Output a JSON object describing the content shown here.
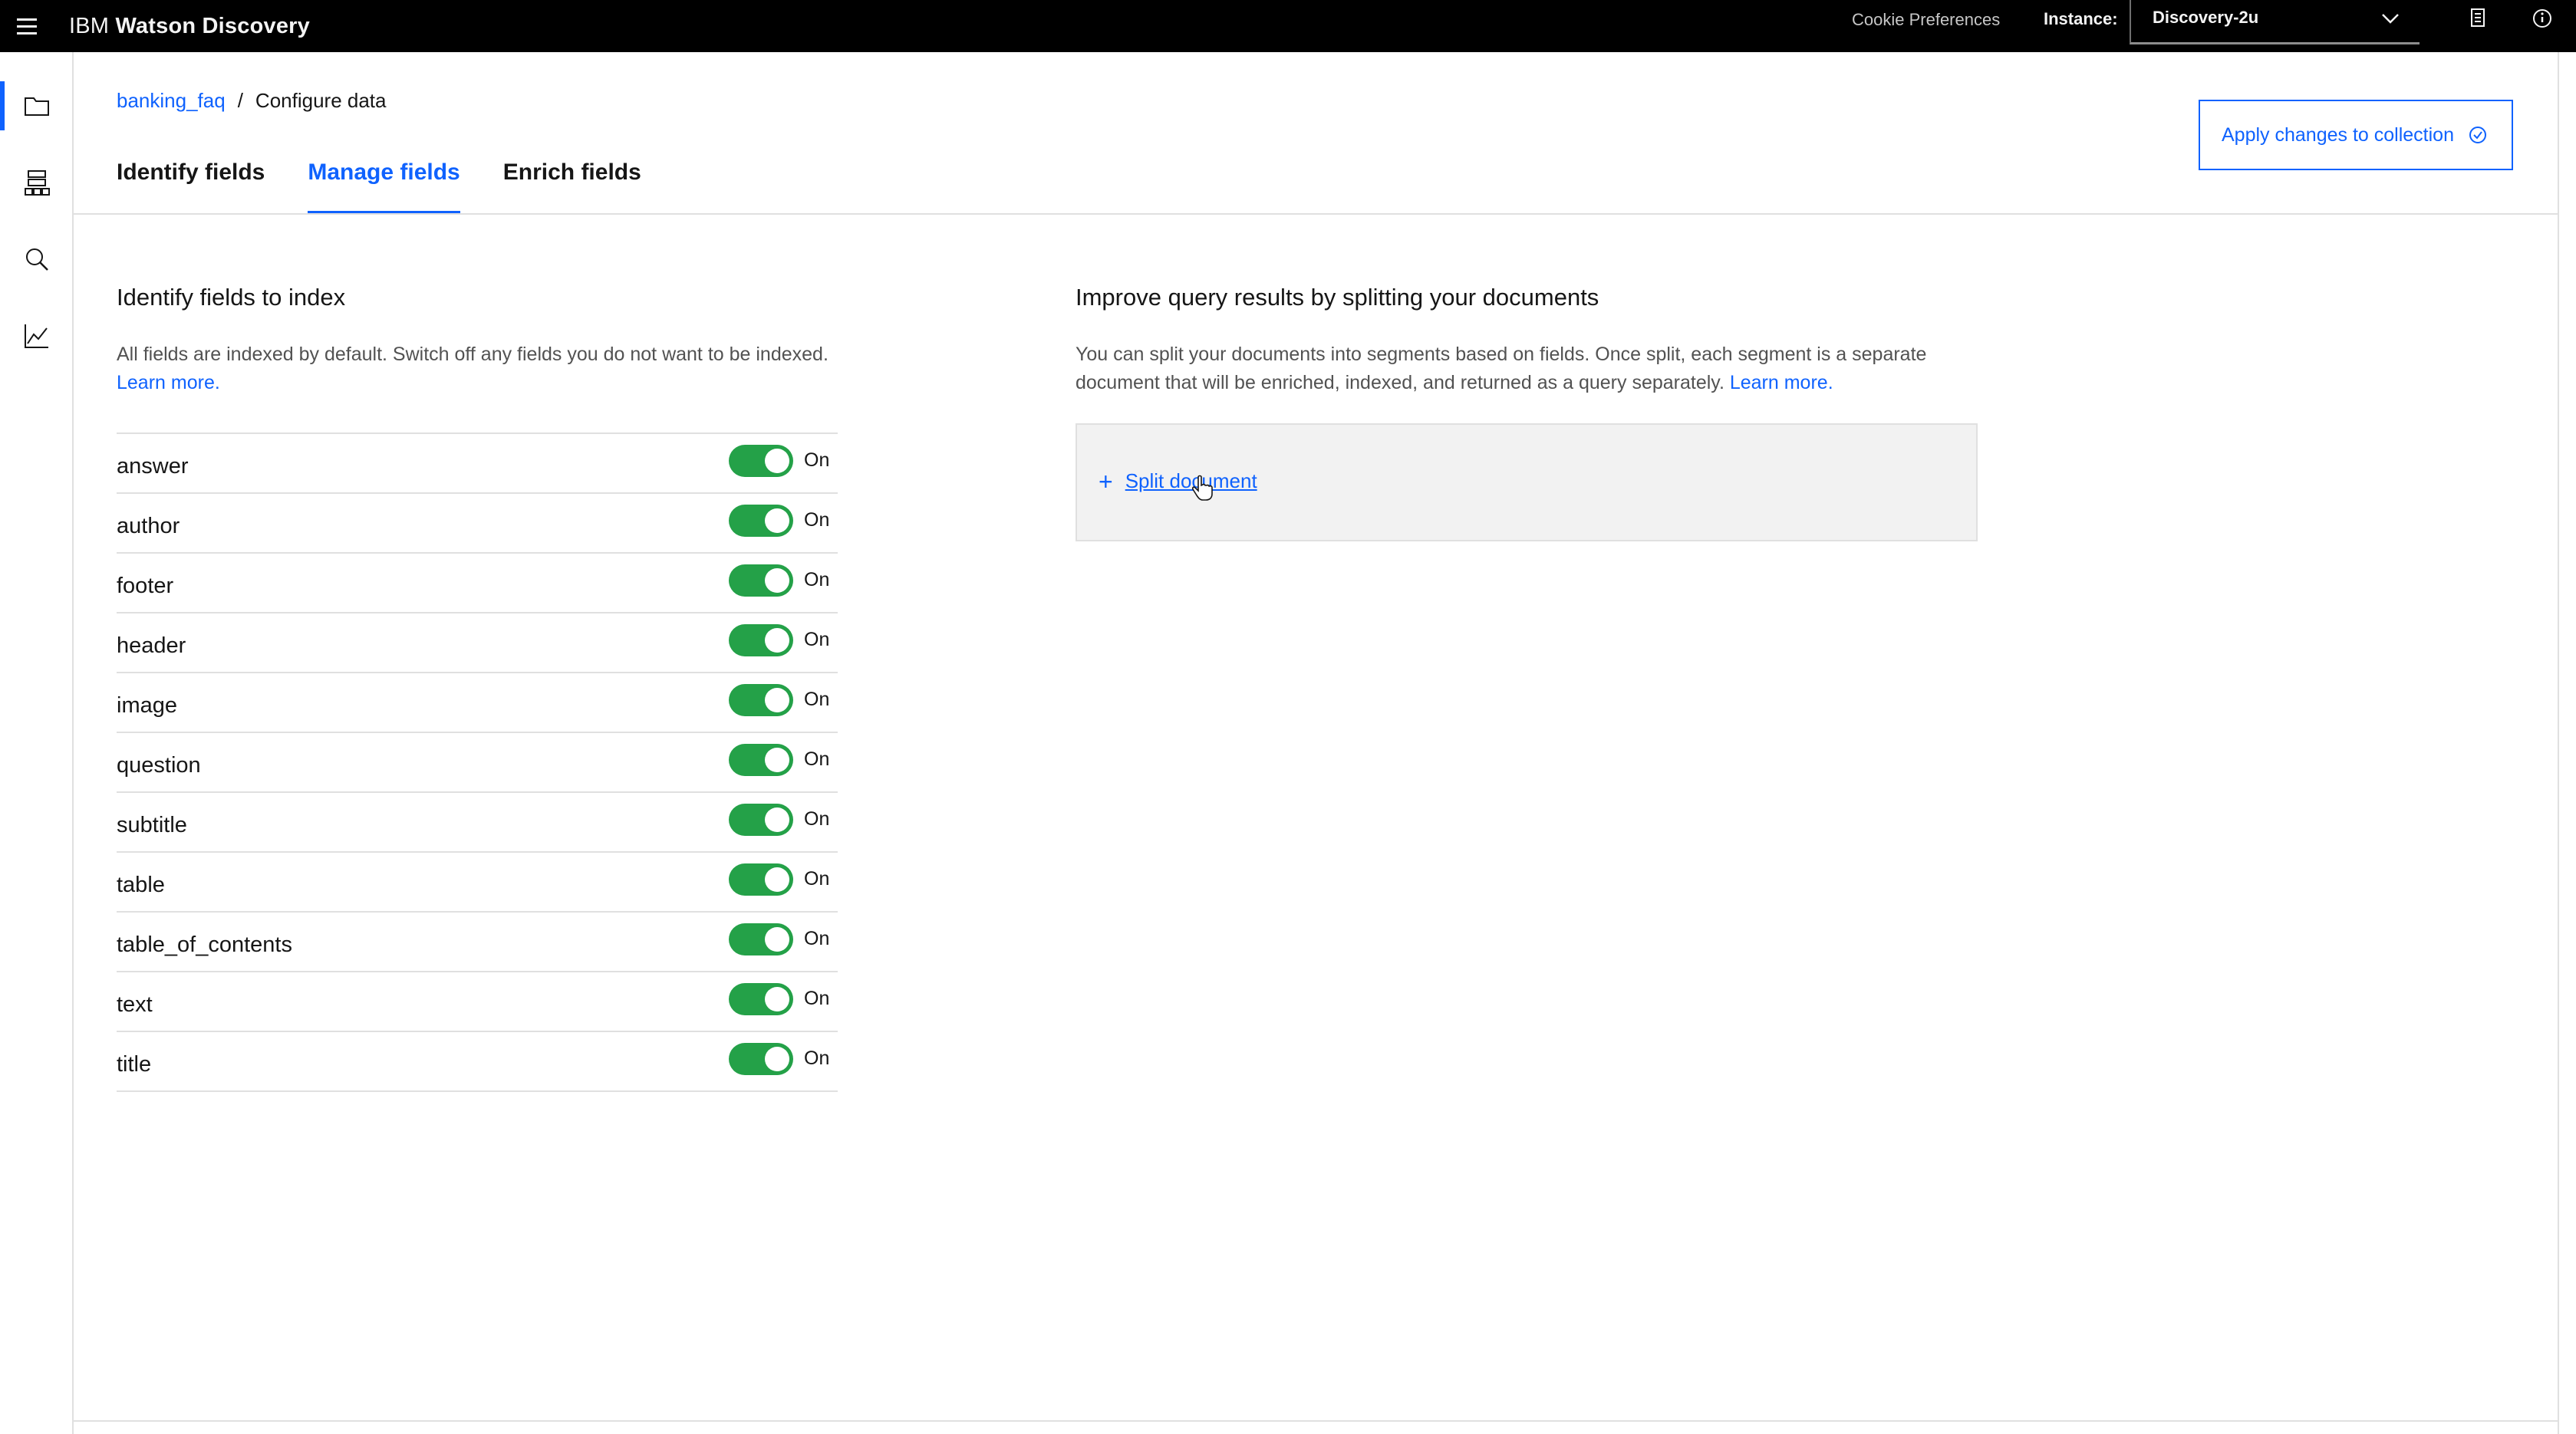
{
  "header": {
    "brand_prefix": "IBM",
    "brand_product": "Watson Discovery",
    "cookie_preferences": "Cookie Preferences",
    "instance_label": "Instance:",
    "instance_value": "Discovery-2u",
    "icons": [
      "menu-icon",
      "chevron-down-icon",
      "document-icon",
      "help-icon"
    ]
  },
  "rail": {
    "items": [
      {
        "name": "projects",
        "icon": "folder-icon",
        "active": true
      },
      {
        "name": "data-tree",
        "icon": "tree-icon",
        "active": false
      },
      {
        "name": "search",
        "icon": "search-icon",
        "active": false
      },
      {
        "name": "analytics",
        "icon": "chart-icon",
        "active": false
      }
    ]
  },
  "breadcrumb": {
    "collection": "banking_faq",
    "separator": "/",
    "current": "Configure data"
  },
  "tabs": [
    {
      "label": "Identify fields",
      "selected": false
    },
    {
      "label": "Manage fields",
      "selected": true
    },
    {
      "label": "Enrich fields",
      "selected": false
    }
  ],
  "apply_button": {
    "label": "Apply changes to collection",
    "icon": "checkmark-outline-icon"
  },
  "left_panel": {
    "title": "Identify fields to index",
    "description": "All fields are indexed by default. Switch off any fields you do not want to be indexed.",
    "learn_more": "Learn more.",
    "fields": [
      {
        "name": "answer",
        "state": "On"
      },
      {
        "name": "author",
        "state": "On"
      },
      {
        "name": "footer",
        "state": "On"
      },
      {
        "name": "header",
        "state": "On"
      },
      {
        "name": "image",
        "state": "On"
      },
      {
        "name": "question",
        "state": "On"
      },
      {
        "name": "subtitle",
        "state": "On"
      },
      {
        "name": "table",
        "state": "On"
      },
      {
        "name": "table_of_contents",
        "state": "On"
      },
      {
        "name": "text",
        "state": "On"
      },
      {
        "name": "title",
        "state": "On"
      }
    ]
  },
  "right_panel": {
    "title": "Improve query results by splitting your documents",
    "description": "You can split your documents into segments based on fields. Once split, each segment is a separate document that will be enriched, indexed, and returned as a query separately.",
    "learn_more": "Learn more.",
    "split_plus": "+",
    "split_label": "Split document"
  },
  "colors": {
    "accent": "#0f62fe",
    "toggle_on": "#24a148",
    "topbar": "#000000",
    "panel_bg": "#f2f2f2"
  }
}
